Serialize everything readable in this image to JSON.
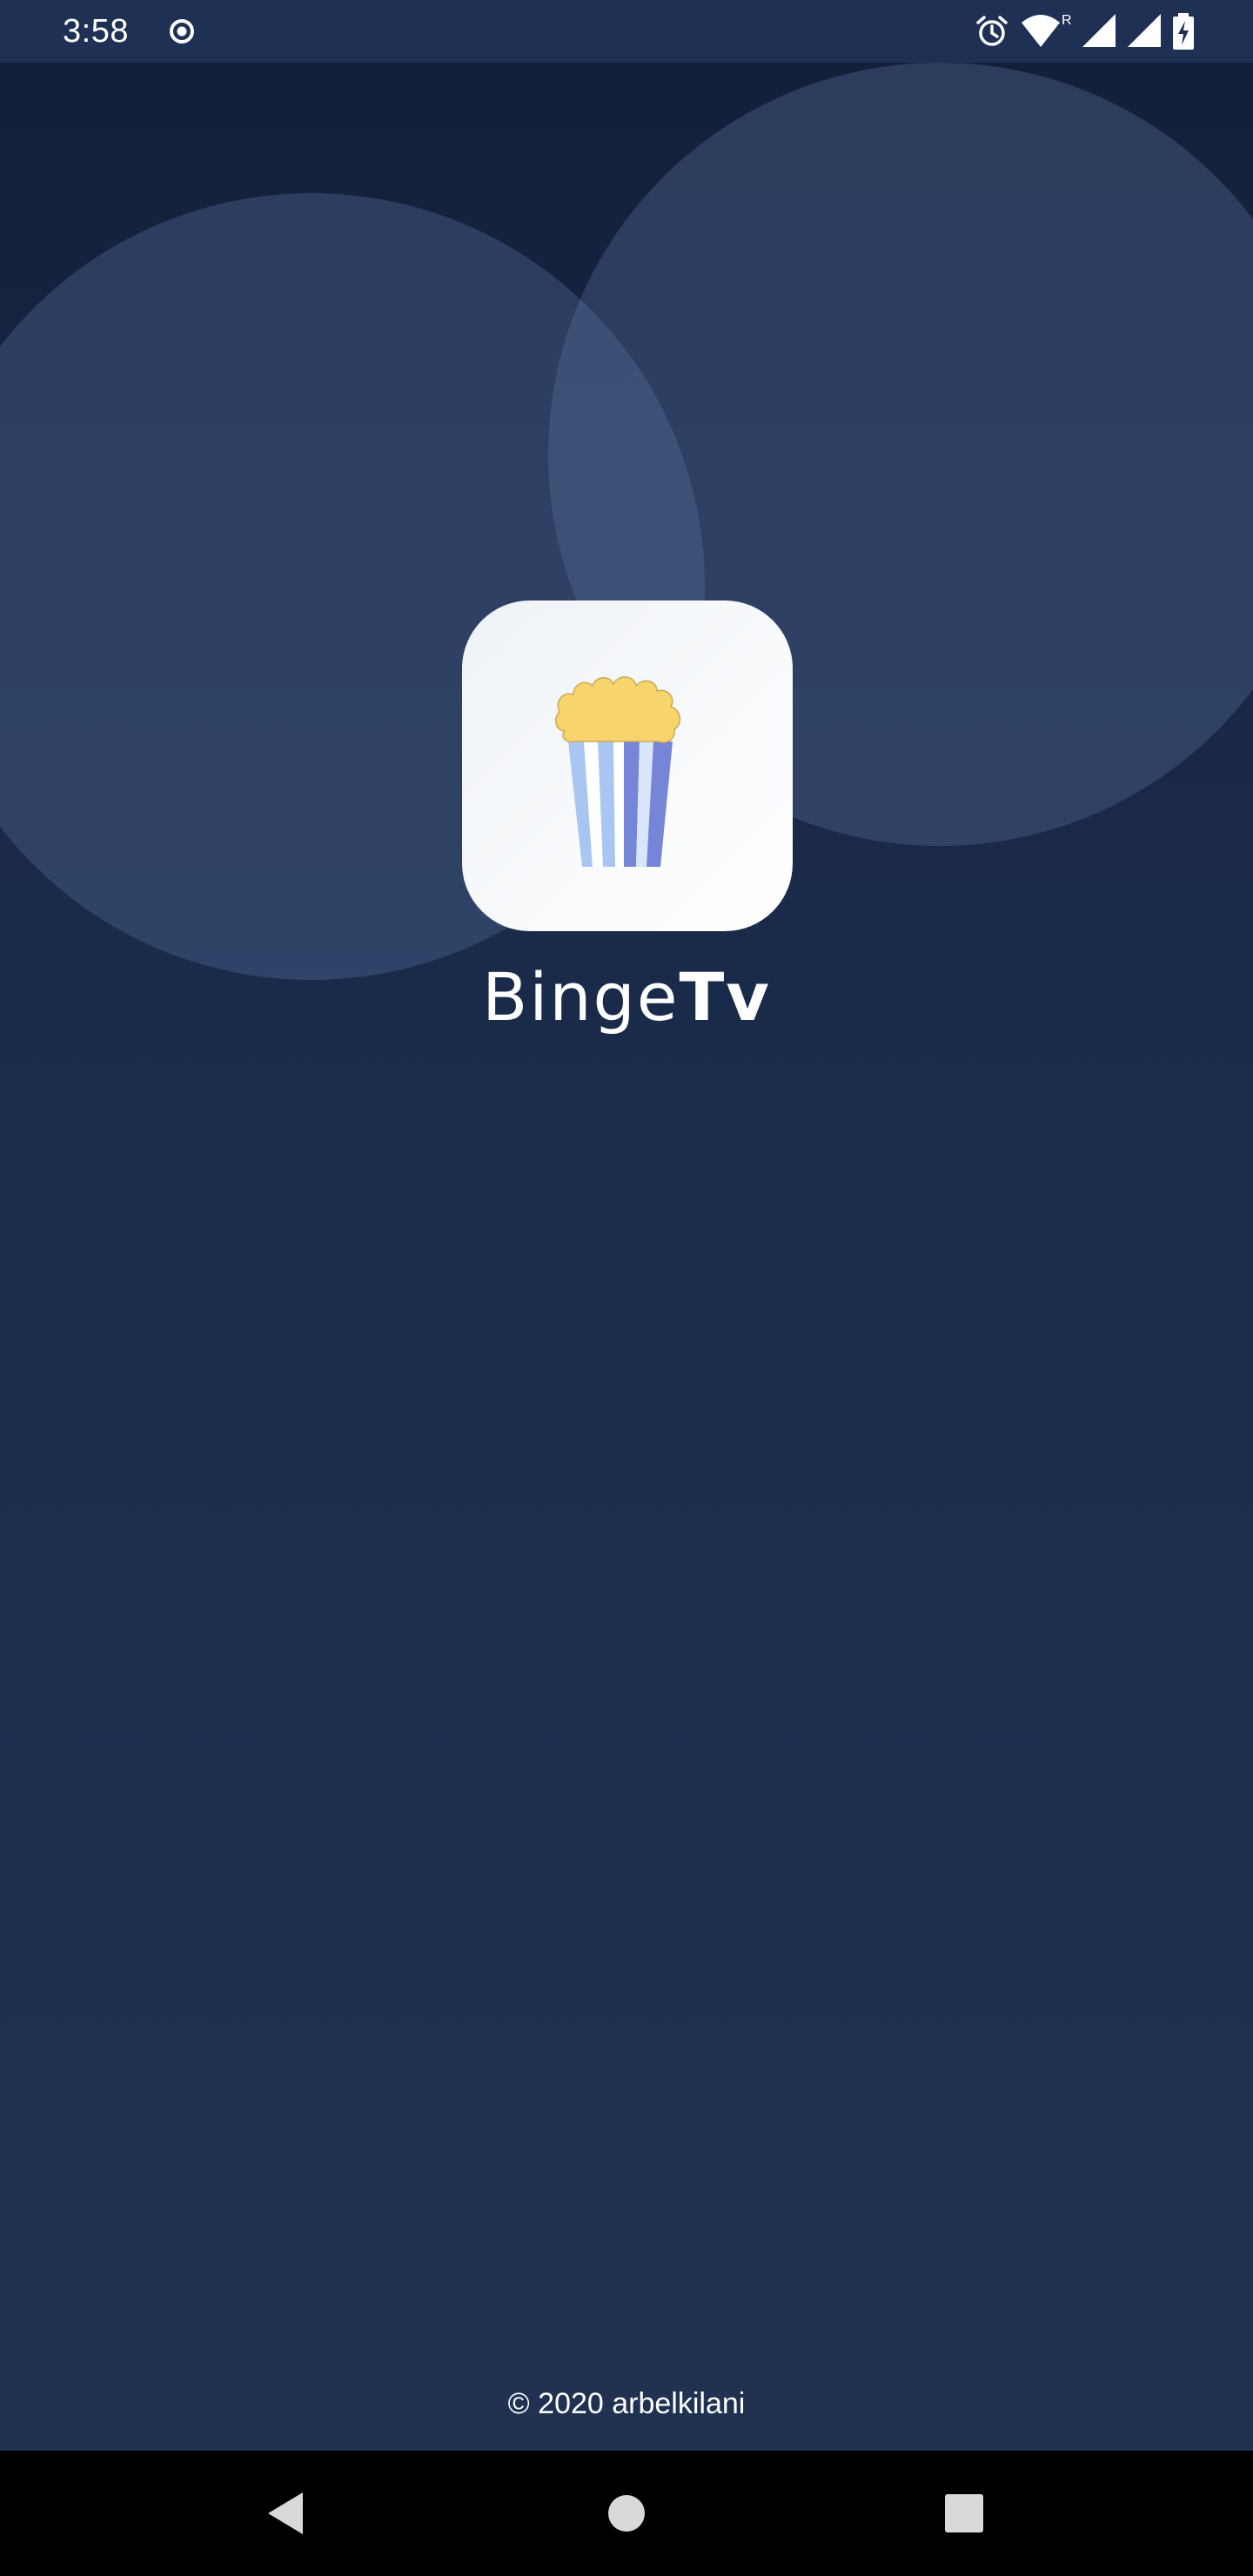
{
  "status_bar": {
    "time": "3:58",
    "icons": [
      "record-icon",
      "alarm-icon",
      "wifi-icon",
      "roaming-indicator",
      "signal-icon",
      "signal-icon",
      "battery-charging-icon"
    ],
    "roaming_label": "R"
  },
  "app": {
    "name_light": "Binge",
    "name_bold": "Tv",
    "logo_icon": "popcorn-icon"
  },
  "footer": {
    "copyright": "© 2020 arbelkilani"
  },
  "nav_bar": {
    "buttons": [
      "back-icon",
      "home-icon",
      "recents-icon"
    ]
  },
  "colors": {
    "background_top": "#131f38",
    "background_bottom": "#203252",
    "status_bar": "#1f3055",
    "popcorn": "#f8d46c",
    "stripe_light": "#a9c6f2",
    "stripe_dark": "#7785d8"
  }
}
